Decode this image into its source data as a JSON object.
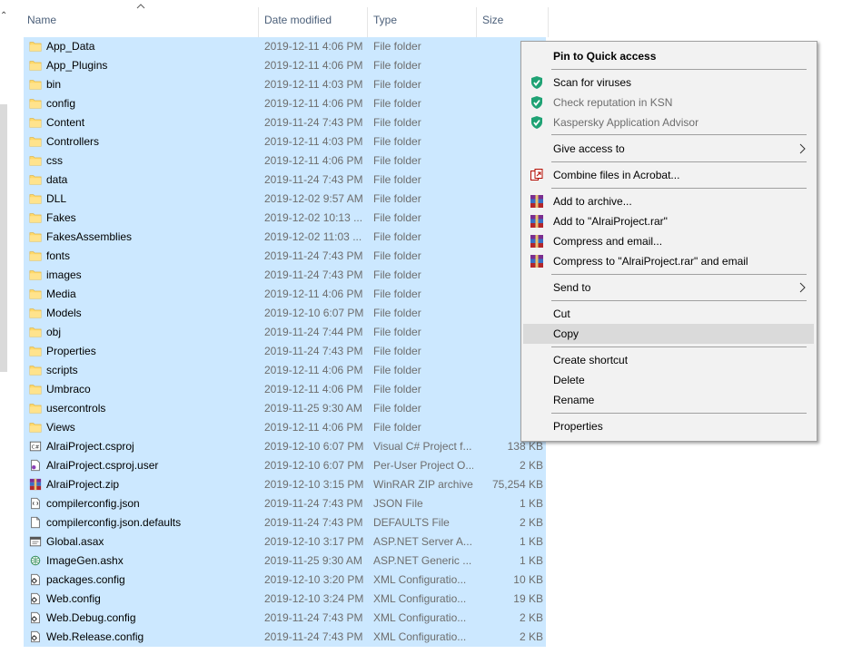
{
  "header": {
    "name": "Name",
    "date_modified": "Date modified",
    "type": "Type",
    "size": "Size"
  },
  "files": [
    {
      "name": "App_Data",
      "date": "2019-12-11 4:06 PM",
      "type": "File folder",
      "size": "",
      "icon": "folder-icon"
    },
    {
      "name": "App_Plugins",
      "date": "2019-12-11 4:06 PM",
      "type": "File folder",
      "size": "",
      "icon": "folder-icon"
    },
    {
      "name": "bin",
      "date": "2019-12-11 4:03 PM",
      "type": "File folder",
      "size": "",
      "icon": "folder-icon"
    },
    {
      "name": "config",
      "date": "2019-12-11 4:06 PM",
      "type": "File folder",
      "size": "",
      "icon": "folder-icon"
    },
    {
      "name": "Content",
      "date": "2019-11-24 7:43 PM",
      "type": "File folder",
      "size": "",
      "icon": "folder-icon"
    },
    {
      "name": "Controllers",
      "date": "2019-12-11 4:03 PM",
      "type": "File folder",
      "size": "",
      "icon": "folder-icon"
    },
    {
      "name": "css",
      "date": "2019-12-11 4:06 PM",
      "type": "File folder",
      "size": "",
      "icon": "folder-icon"
    },
    {
      "name": "data",
      "date": "2019-11-24 7:43 PM",
      "type": "File folder",
      "size": "",
      "icon": "folder-icon"
    },
    {
      "name": "DLL",
      "date": "2019-12-02 9:57 AM",
      "type": "File folder",
      "size": "",
      "icon": "folder-icon"
    },
    {
      "name": "Fakes",
      "date": "2019-12-02 10:13 ...",
      "type": "File folder",
      "size": "",
      "icon": "folder-icon"
    },
    {
      "name": "FakesAssemblies",
      "date": "2019-12-02 11:03 ...",
      "type": "File folder",
      "size": "",
      "icon": "folder-icon"
    },
    {
      "name": "fonts",
      "date": "2019-11-24 7:43 PM",
      "type": "File folder",
      "size": "",
      "icon": "folder-icon"
    },
    {
      "name": "images",
      "date": "2019-11-24 7:43 PM",
      "type": "File folder",
      "size": "",
      "icon": "folder-icon"
    },
    {
      "name": "Media",
      "date": "2019-12-11 4:06 PM",
      "type": "File folder",
      "size": "",
      "icon": "folder-icon"
    },
    {
      "name": "Models",
      "date": "2019-12-10 6:07 PM",
      "type": "File folder",
      "size": "",
      "icon": "folder-icon"
    },
    {
      "name": "obj",
      "date": "2019-11-24 7:44 PM",
      "type": "File folder",
      "size": "",
      "icon": "folder-icon"
    },
    {
      "name": "Properties",
      "date": "2019-11-24 7:43 PM",
      "type": "File folder",
      "size": "",
      "icon": "folder-icon"
    },
    {
      "name": "scripts",
      "date": "2019-12-11 4:06 PM",
      "type": "File folder",
      "size": "",
      "icon": "folder-icon"
    },
    {
      "name": "Umbraco",
      "date": "2019-12-11 4:06 PM",
      "type": "File folder",
      "size": "",
      "icon": "folder-icon"
    },
    {
      "name": "usercontrols",
      "date": "2019-11-25 9:30 AM",
      "type": "File folder",
      "size": "",
      "icon": "folder-icon"
    },
    {
      "name": "Views",
      "date": "2019-12-11 4:06 PM",
      "type": "File folder",
      "size": "",
      "icon": "folder-icon"
    },
    {
      "name": "AlraiProject.csproj",
      "date": "2019-12-10 6:07 PM",
      "type": "Visual C# Project f...",
      "size": "138 KB",
      "icon": "csproj-icon"
    },
    {
      "name": "AlraiProject.csproj.user",
      "date": "2019-12-10 6:07 PM",
      "type": "Per-User Project O...",
      "size": "2 KB",
      "icon": "user-file-icon"
    },
    {
      "name": "AlraiProject.zip",
      "date": "2019-12-10 3:15 PM",
      "type": "WinRAR ZIP archive",
      "size": "75,254 KB",
      "icon": "winrar-icon"
    },
    {
      "name": "compilerconfig.json",
      "date": "2019-11-24 7:43 PM",
      "type": "JSON File",
      "size": "1 KB",
      "icon": "json-icon"
    },
    {
      "name": "compilerconfig.json.defaults",
      "date": "2019-11-24 7:43 PM",
      "type": "DEFAULTS File",
      "size": "2 KB",
      "icon": "blank-file-icon"
    },
    {
      "name": "Global.asax",
      "date": "2019-12-10 3:17 PM",
      "type": "ASP.NET Server A...",
      "size": "1 KB",
      "icon": "asax-icon"
    },
    {
      "name": "ImageGen.ashx",
      "date": "2019-11-25 9:30 AM",
      "type": "ASP.NET Generic ...",
      "size": "1 KB",
      "icon": "ashx-icon"
    },
    {
      "name": "packages.config",
      "date": "2019-12-10 3:20 PM",
      "type": "XML Configuratio...",
      "size": "10 KB",
      "icon": "config-icon"
    },
    {
      "name": "Web.config",
      "date": "2019-12-10 3:24 PM",
      "type": "XML Configuratio...",
      "size": "19 KB",
      "icon": "config-icon"
    },
    {
      "name": "Web.Debug.config",
      "date": "2019-11-24 7:43 PM",
      "type": "XML Configuratio...",
      "size": "2 KB",
      "icon": "config-icon"
    },
    {
      "name": "Web.Release.config",
      "date": "2019-11-24 7:43 PM",
      "type": "XML Configuratio...",
      "size": "2 KB",
      "icon": "config-icon"
    }
  ],
  "menu": {
    "pin": "Pin to Quick access",
    "scan": "Scan for viruses",
    "check_rep": "Check reputation in KSN",
    "advisor": "Kaspersky Application Advisor",
    "give_access": "Give access to",
    "combine": "Combine files in Acrobat...",
    "add_archive": "Add to archive...",
    "add_rar": "Add to \"AlraiProject.rar\"",
    "compress_email": "Compress and email...",
    "compress_rar_email": "Compress to \"AlraiProject.rar\" and email",
    "send_to": "Send to",
    "cut": "Cut",
    "copy": "Copy",
    "create_shortcut": "Create shortcut",
    "delete": "Delete",
    "rename": "Rename",
    "properties": "Properties"
  },
  "colors": {
    "selection": "#cce8ff",
    "menu_bg": "#f2f2f2",
    "menu_highlight": "#dadada",
    "kaspersky_green": "#1fa274",
    "folder_yellow": "#ffd96a"
  }
}
